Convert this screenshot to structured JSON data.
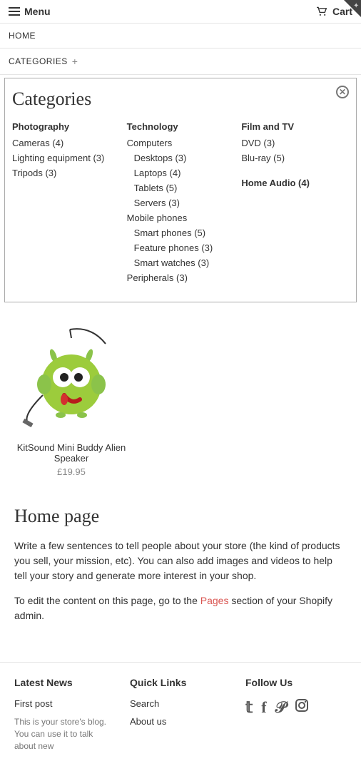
{
  "header": {
    "menu": "Menu",
    "cart": "Cart"
  },
  "nav": {
    "home": "HOME",
    "categories": "CATEGORIES"
  },
  "catbox": {
    "title": "Categories",
    "col1": {
      "head": "Photography",
      "items": [
        "Cameras (4)",
        "Lighting equipment (3)",
        "Tripods (3)"
      ]
    },
    "col2": {
      "head": "Technology",
      "computers": "Computers",
      "computers_sub": [
        "Desktops (3)",
        "Laptops (4)",
        "Tablets (5)",
        "Servers (3)"
      ],
      "mobile": "Mobile phones",
      "mobile_sub": [
        "Smart phones (5)",
        "Feature phones (3)",
        "Smart watches (3)"
      ],
      "peripherals": "Peripherals (3)"
    },
    "col3": {
      "head1": "Film and TV",
      "items1": [
        "DVD (3)",
        "Blu-ray (5)"
      ],
      "head2": "Home Audio (4)"
    }
  },
  "product": {
    "name": "KitSound Mini Buddy Alien Speaker",
    "price": "£19.95"
  },
  "home": {
    "title": "Home page",
    "p1": "Write a few sentences to tell people about your store (the kind of products you sell, your mission, etc). You can also add images and videos to help tell your story and generate more interest in your shop.",
    "p2a": "To edit the content on this page, go to the ",
    "p2link": "Pages",
    "p2b": " section of your Shopify admin."
  },
  "footer": {
    "news_head": "Latest News",
    "news_link": "First post",
    "news_blurb": "This is your store's blog. You can use it to talk about new",
    "quick_head": "Quick Links",
    "quick_search": "Search",
    "quick_about": "About us",
    "follow_head": "Follow Us"
  }
}
